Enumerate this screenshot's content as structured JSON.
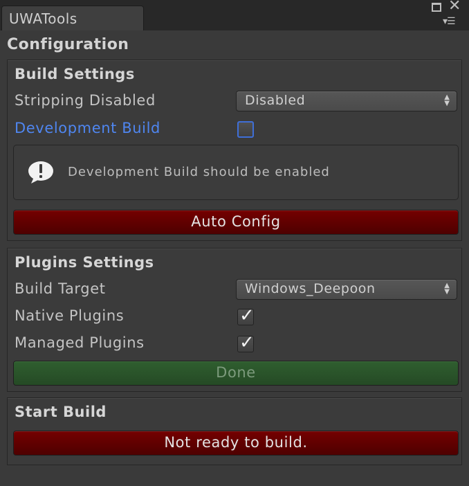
{
  "window": {
    "tab_label": "UWATools",
    "icons": [
      "maximize-icon",
      "close-icon",
      "tab-menu-icon"
    ]
  },
  "title": "Configuration",
  "build_settings": {
    "title": "Build Settings",
    "stripping_label": "Stripping Disabled",
    "stripping_value": "Disabled",
    "dev_build_label": "Development Build",
    "dev_build_checked": false,
    "help_text": "Development Build should be enabled",
    "auto_config_label": "Auto Config"
  },
  "plugins_settings": {
    "title": "Plugins Settings",
    "build_target_label": "Build Target",
    "build_target_value": "Windows_Deepoon",
    "native_plugins_label": "Native Plugins",
    "native_plugins_checked": true,
    "managed_plugins_label": "Managed Plugins",
    "managed_plugins_checked": true,
    "done_label": "Done"
  },
  "start_build": {
    "title": "Start Build",
    "status_button_label": "Not ready to build."
  },
  "colors": {
    "error_button": "#5e0000",
    "ok_button": "#2a522a",
    "highlight_label": "#4f86f0"
  }
}
